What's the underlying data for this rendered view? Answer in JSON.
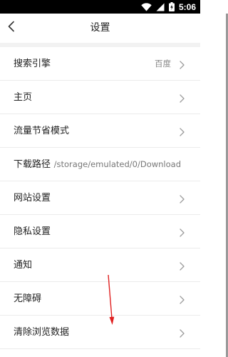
{
  "status_bar": {
    "time": "5:06",
    "icons": [
      "wifi-icon",
      "signal-icon",
      "battery-charging-icon"
    ]
  },
  "app_bar": {
    "title": "设置",
    "back_icon": "chevron-left-icon"
  },
  "settings": {
    "items": [
      {
        "label": "搜索引擎",
        "value": "百度",
        "has_chevron": true
      },
      {
        "label": "主页",
        "value": "",
        "has_chevron": true
      },
      {
        "label": "流量节省模式",
        "value": "",
        "has_chevron": true
      },
      {
        "label": "下载路径",
        "value": "/storage/emulated/0/Download",
        "has_chevron": false
      },
      {
        "label": "网站设置",
        "value": "",
        "has_chevron": true
      },
      {
        "label": "隐私设置",
        "value": "",
        "has_chevron": true
      },
      {
        "label": "通知",
        "value": "",
        "has_chevron": true
      },
      {
        "label": "无障碍",
        "value": "",
        "has_chevron": true
      },
      {
        "label": "清除浏览数据",
        "value": "",
        "has_chevron": true
      }
    ]
  },
  "colors": {
    "annotation_arrow": "#e02020",
    "text_primary": "#222222",
    "text_secondary": "#888888",
    "divider": "#ebebeb"
  }
}
